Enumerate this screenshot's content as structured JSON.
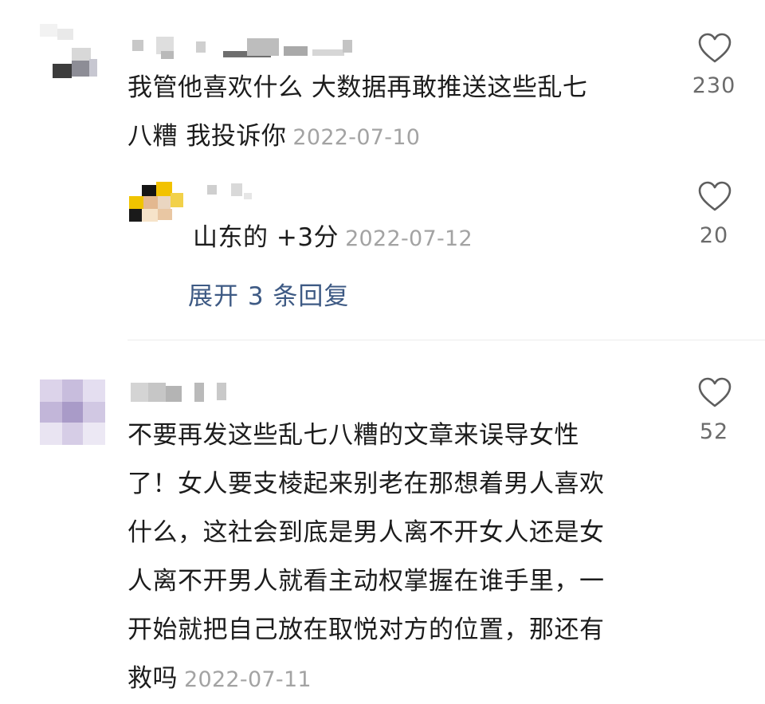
{
  "comments": [
    {
      "text_line1": "我管他喜欢什么 大数据再敢推送这些乱七",
      "text_line2": "八糟 我投诉你",
      "date": "2022-07-10",
      "likes": "230",
      "reply": {
        "text": "山东的 +3分",
        "date": "2022-07-12",
        "likes": "20"
      },
      "expand_label": "展开 3 条回复"
    },
    {
      "lines": [
        "不要再发这些乱七八糟的文章来误导女性",
        "了！女人要支棱起来别老在那想着男人喜欢",
        "什么，这社会到底是男人离不开女人还是女",
        "人离不开男人就看主动权掌握在谁手里，一",
        "开始就把自己放在取悦对方的位置，那还有",
        "救吗"
      ],
      "date": "2022-07-11",
      "likes": "52"
    }
  ],
  "icons": {
    "like": "heart-outline-icon"
  },
  "colors": {
    "text": "#1c1c1c",
    "date": "#a3a3a3",
    "link": "#3e5a84",
    "count": "#6b6b6b"
  }
}
